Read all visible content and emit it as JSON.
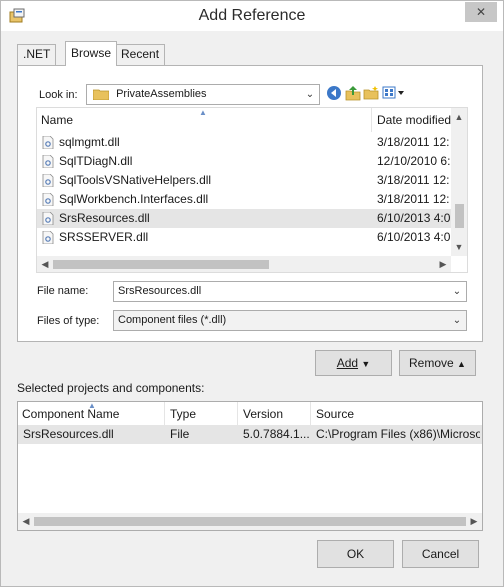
{
  "window": {
    "title": "Add Reference",
    "close_glyph": "✕"
  },
  "tabs": [
    {
      "label": ".NET",
      "active": false
    },
    {
      "label": "Browse",
      "active": true
    },
    {
      "label": "Recent",
      "active": false
    }
  ],
  "browse": {
    "look_in_label": "Look in:",
    "look_in_value": "PrivateAssemblies",
    "columns": [
      "Name",
      "Date modified"
    ],
    "files": [
      {
        "name": "sqlmgmt.dll",
        "date": "3/18/2011 12:",
        "selected": false
      },
      {
        "name": "SqlTDiagN.dll",
        "date": "12/10/2010 6:",
        "selected": false
      },
      {
        "name": "SqlToolsVSNativeHelpers.dll",
        "date": "3/18/2011 12:",
        "selected": false
      },
      {
        "name": "SqlWorkbench.Interfaces.dll",
        "date": "3/18/2011 12:",
        "selected": false
      },
      {
        "name": "SrsResources.dll",
        "date": "6/10/2013 4:0",
        "selected": true
      },
      {
        "name": "SRSSERVER.dll",
        "date": "6/10/2013 4:0",
        "selected": false
      }
    ],
    "file_name_label": "File name:",
    "file_name_value": "SrsResources.dll",
    "files_of_type_label": "Files of type:",
    "files_of_type_value": "Component files (*.dll)"
  },
  "actions": {
    "add_label": "Add",
    "remove_label": "Remove"
  },
  "selected": {
    "label": "Selected projects and components:",
    "columns": [
      "Component Name",
      "Type",
      "Version",
      "Source"
    ],
    "rows": [
      {
        "name": "SrsResources.dll",
        "type": "File",
        "version": "5.0.7884.1...",
        "source": "C:\\Program Files (x86)\\Microso"
      }
    ]
  },
  "footer": {
    "ok_label": "OK",
    "cancel_label": "Cancel"
  },
  "colors": {
    "selection": "#e5e5e5",
    "accent": "#3c78c8",
    "folder": "#e8c15c"
  }
}
